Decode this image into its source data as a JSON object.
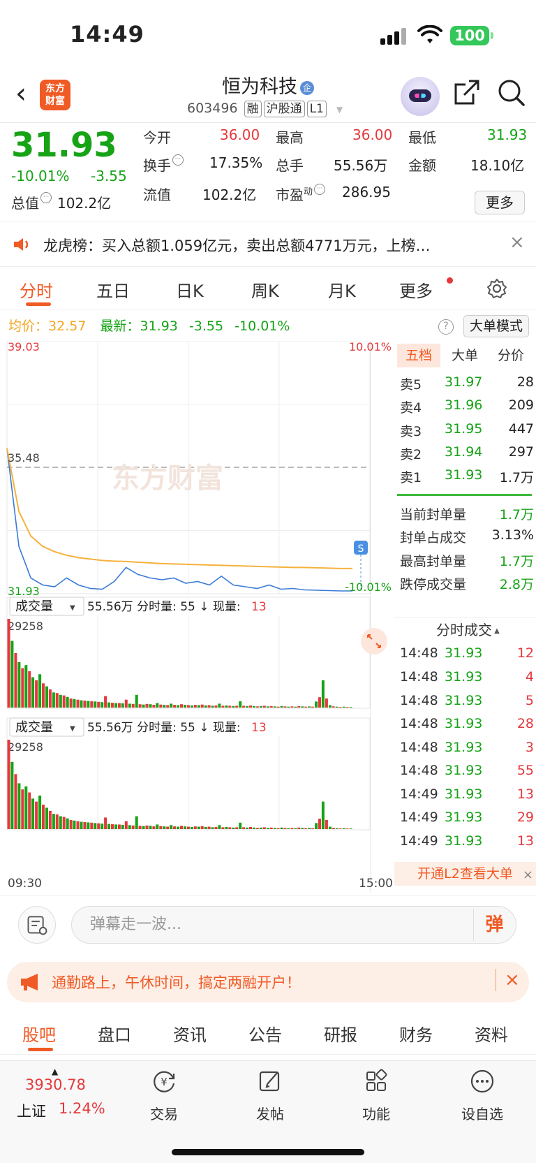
{
  "status_bar": {
    "time": "14:49",
    "battery": "100"
  },
  "header": {
    "back": "‹",
    "logo_line1": "东方",
    "logo_line2": "财富",
    "stock_name": "恒为科技",
    "stock_badge": "企",
    "stock_code": "603496",
    "tags": [
      "融",
      "沪股通",
      "L1"
    ]
  },
  "quote": {
    "price": "31.93",
    "change_pct": "-10.01%",
    "change": "-3.55",
    "total_value_label": "总值",
    "total_value": "102.2亿",
    "open_label": "今开",
    "open": "36.00",
    "high_label": "最高",
    "high": "36.00",
    "low_label": "最低",
    "low": "31.93",
    "turnover_label": "换手",
    "turnover": "17.35%",
    "volume_label": "总手",
    "volume": "55.56万",
    "amount_label": "金额",
    "amount": "18.10亿",
    "float_value_label": "流值",
    "float_value": "102.2亿",
    "pe_label": "市盈",
    "pe_sup": "动",
    "pe": "286.95",
    "more_label": "更多"
  },
  "notice": {
    "text": "龙虎榜：买入总额1.059亿元，卖出总额4771万元，上榜…",
    "close": "×"
  },
  "tabs": [
    "分时",
    "五日",
    "日K",
    "周K",
    "月K",
    "更多"
  ],
  "legend": {
    "avg_label": "均价：",
    "avg_value": "32.57",
    "latest_label": "最新：",
    "latest_value": "31.93",
    "latest_change": "-3.55",
    "latest_pct": "-10.01%",
    "help": "?",
    "big_mode": "大单模式"
  },
  "chart_data": {
    "type": "line",
    "y_top_label": "39.03",
    "y_mid_label": "35.48",
    "y_bottom_label": "31.93",
    "pct_top_label": "10.01%",
    "pct_bottom_label": "-10.01%",
    "ylim": [
      31.93,
      39.03
    ],
    "series": [
      {
        "values": [
          36.0,
          33.2,
          32.3,
          32.1,
          32.05,
          32.3,
          32.1,
          32.0,
          31.98,
          32.2,
          32.6,
          32.4,
          32.3,
          32.25,
          32.3,
          32.15,
          32.2,
          32.1,
          32.35,
          32.1,
          32.05,
          32.0,
          32.1,
          31.98,
          32.0,
          31.96,
          31.95,
          31.94,
          31.93,
          31.93
        ]
      },
      {
        "values": [
          36.0,
          34.2,
          33.5,
          33.2,
          33.05,
          32.95,
          32.88,
          32.84,
          32.8,
          32.78,
          32.77,
          32.75,
          32.73,
          32.71,
          32.7,
          32.69,
          32.68,
          32.67,
          32.66,
          32.65,
          32.64,
          32.63,
          32.62,
          32.61,
          32.6,
          32.6,
          32.59,
          32.58,
          32.57,
          32.57
        ]
      }
    ],
    "volume_panel": {
      "selector": "成交量",
      "summary": "55.56万 分时量: 55 ↓ 现量:",
      "current": "13",
      "max_label": "29258",
      "values": [
        29258,
        22000,
        18000,
        15000,
        13000,
        14000,
        12000,
        10000,
        9000,
        11000,
        8000,
        7000,
        6000,
        5000,
        4800,
        4200,
        4000,
        3500,
        3000,
        2800,
        2600,
        2400,
        2300,
        2200,
        2100,
        2000,
        1900,
        1800,
        3800,
        1700,
        1600,
        1500,
        1500,
        1400,
        2600,
        1300,
        1200,
        4200,
        1100,
        1000,
        1200,
        1100,
        900,
        1500,
        1000,
        900,
        800,
        1300,
        900,
        800,
        1100,
        900,
        800,
        700,
        900,
        800,
        1000,
        700,
        800,
        600,
        700,
        1300,
        600,
        700,
        600,
        500,
        600,
        2100,
        600,
        500,
        700,
        500,
        400,
        500,
        600,
        400,
        500,
        400,
        300,
        500,
        400,
        300,
        400,
        300,
        500,
        400,
        300,
        400,
        300,
        2000,
        3400,
        9000,
        3000,
        800,
        400,
        300,
        200,
        300,
        200,
        200
      ],
      "colors_pattern": [
        "red",
        "green"
      ]
    },
    "x_start": "09:30",
    "x_end": "15:00",
    "watermark": "东方财富",
    "marker": "S"
  },
  "order_book": {
    "tabs": [
      "五档",
      "大单",
      "分价"
    ],
    "asks": [
      {
        "label": "卖5",
        "price": "31.97",
        "vol": "28"
      },
      {
        "label": "卖4",
        "price": "31.96",
        "vol": "209"
      },
      {
        "label": "卖3",
        "price": "31.95",
        "vol": "447"
      },
      {
        "label": "卖2",
        "price": "31.94",
        "vol": "297"
      },
      {
        "label": "卖1",
        "price": "31.93",
        "vol": "1.7万"
      }
    ],
    "stats": [
      {
        "label": "当前封单量",
        "value": "1.7万"
      },
      {
        "label": "封单占成交",
        "value": "3.13%"
      },
      {
        "label": "最高封单量",
        "value": "1.7万"
      },
      {
        "label": "跌停成交量",
        "value": "2.8万"
      }
    ],
    "trades_title": "分时成交",
    "trades": [
      {
        "time": "14:48",
        "price": "31.93",
        "vol": "12"
      },
      {
        "time": "14:48",
        "price": "31.93",
        "vol": "4"
      },
      {
        "time": "14:48",
        "price": "31.93",
        "vol": "5"
      },
      {
        "time": "14:48",
        "price": "31.93",
        "vol": "28"
      },
      {
        "time": "14:48",
        "price": "31.93",
        "vol": "3"
      },
      {
        "time": "14:48",
        "price": "31.93",
        "vol": "55"
      },
      {
        "time": "14:49",
        "price": "31.93",
        "vol": "13"
      },
      {
        "time": "14:49",
        "price": "31.93",
        "vol": "29"
      },
      {
        "time": "14:49",
        "price": "31.93",
        "vol": "13"
      }
    ],
    "l2_promo": "开通L2查看大单",
    "l2_close": "×"
  },
  "danmu": {
    "placeholder": "弹幕走一波...",
    "button": "弹"
  },
  "promo": {
    "text": "通勤路上，午休时间，搞定两融开户！",
    "close": "×"
  },
  "sub_tabs": [
    "股吧",
    "盘口",
    "资讯",
    "公告",
    "研报",
    "财务",
    "资料"
  ],
  "bottom_bar": {
    "index_value": "3930.78",
    "index_name": "上证",
    "index_pct": "1.24%",
    "items": [
      "交易",
      "发帖",
      "功能",
      "设自选"
    ]
  }
}
